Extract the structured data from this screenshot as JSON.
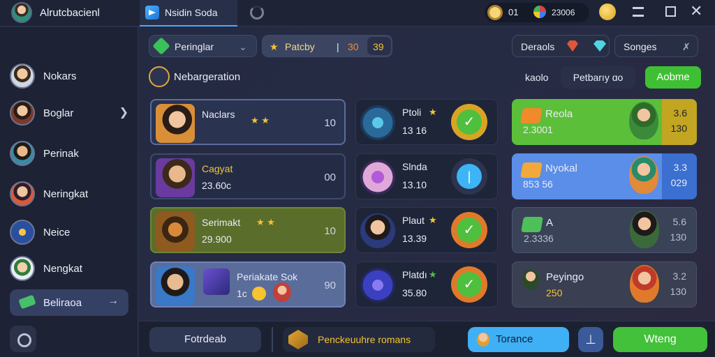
{
  "window": {
    "title": "Alrutcbacienl",
    "tab_label": "Nsidin Soda"
  },
  "top": {
    "coins": "01",
    "gems": "23006"
  },
  "sidebar": {
    "items": [
      {
        "label": "Nokars"
      },
      {
        "label": "Boglar"
      },
      {
        "label": "Perinak"
      },
      {
        "label": "Neringkat"
      },
      {
        "label": "Neice"
      },
      {
        "label": "Nengkat"
      },
      {
        "label": "Beliraoa"
      }
    ]
  },
  "filters": {
    "left_pill": "Peringlar",
    "mid_pill": "Patcby",
    "mid_num_a": "30",
    "mid_num_b": "39",
    "right_pill_a": "Deraols",
    "right_pill_b": "Songes"
  },
  "section": {
    "title": "Nebargeration"
  },
  "actions": {
    "kaolo": "kaolo",
    "dropdown": "Petbarıy ɑo",
    "primary": "Aobme"
  },
  "left_cards": [
    {
      "name": "Naclars",
      "num": "10"
    },
    {
      "name": "Cagyat",
      "sub": "23.60c",
      "num": "00"
    },
    {
      "name": "Serimakt",
      "sub": "29.900",
      "num": "10"
    },
    {
      "name": "Periakate Sok",
      "sub": "1c",
      "num": "90"
    }
  ],
  "mid_cards": [
    {
      "name": "Ptoli",
      "sub": "13 16"
    },
    {
      "name": "Slnda",
      "sub": "13.10"
    },
    {
      "name": "Plaut",
      "sub": "13.39"
    },
    {
      "name": "Platdı",
      "sub": "35.80"
    }
  ],
  "right_cards": [
    {
      "name": "Reola",
      "sub": "2.3001",
      "v1": "3.6",
      "v2": "130"
    },
    {
      "name": "Nyokal",
      "sub": "853 56",
      "v1": "3.3",
      "v2": "029"
    },
    {
      "name": "A",
      "sub": "2.3336",
      "v1": "5.6",
      "v2": "130"
    },
    {
      "name": "Peyingo",
      "sub": "250",
      "v1": "3.2",
      "v2": "130"
    }
  ],
  "bottom": {
    "left": "Fotrdeab",
    "mid": "Penckeuuhre romans",
    "tool": "Torance",
    "action": "Wteng"
  },
  "colors": {
    "accent_green": "#43c13a",
    "accent_blue": "#3fb0f5",
    "gold": "#f4c431"
  }
}
